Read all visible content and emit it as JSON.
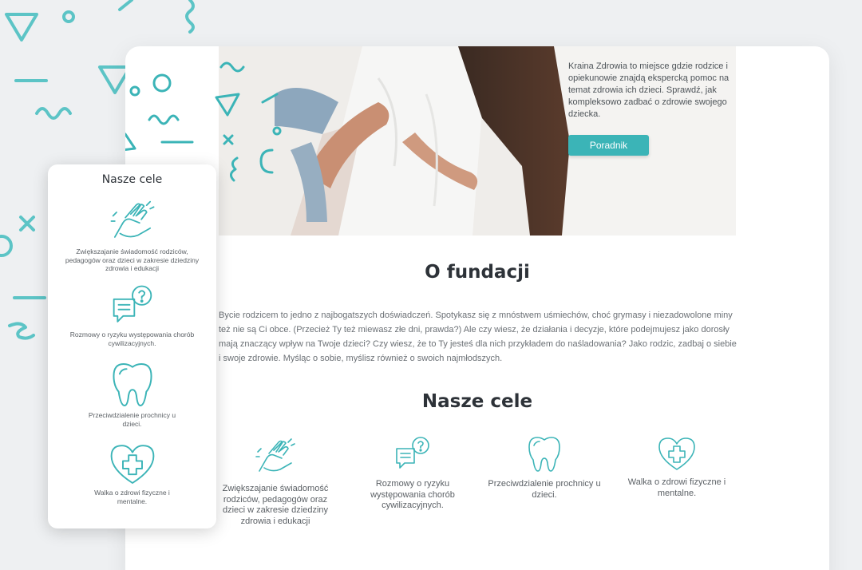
{
  "hero": {
    "description": "Kraina Zdrowia to miejsce gdzie rodzice i opiekunowie znajdą ekspercką pomoc na temat zdrowia ich dzieci. Sprawdź, jak kompleksowo zadbać o zdrowie swojego dziecka.",
    "button_label": "Poradnik"
  },
  "about": {
    "title": "O fundacji",
    "text": "Bycie rodzicem to jedno z najbogatszych doświadczeń. Spotykasz się z mnóstwem uśmiechów, choć grymasy i niezadowolone miny też nie są Ci obce. (Przecież Ty też miewasz złe dni, prawda?) Ale czy wiesz, że działania i decyzje, które podejmujesz jako dorosły mają znaczący wpływ na Twoje dzieci? Czy wiesz, że to Ty jesteś dla nich przykładem do naśladowania? Jako rodzic, zadbaj o siebie i swoje zdrowie. Myśląc o sobie, myślisz również o swoich najmłodszych."
  },
  "goals": {
    "title": "Nasze cele",
    "items": [
      {
        "icon": "hands-icon",
        "label": "Zwiększajanie świadomość rodziców, pedagogów oraz dzieci w zakresie dziedziny zdrowia i edukacji"
      },
      {
        "icon": "chat-question-icon",
        "label": "Rozmowy o ryzyku występowania chorób cywilizacyjnych."
      },
      {
        "icon": "tooth-icon",
        "label": "Przeciwdzialenie prochnicy u dzieci."
      },
      {
        "icon": "heart-cross-icon",
        "label": "Walka o zdrowi fizyczne i mentalne."
      }
    ]
  },
  "mobile": {
    "title": "Nasze cele",
    "items": [
      {
        "icon": "hands-icon",
        "label": "Zwiększajanie świadomość rodziców, pedagogów oraz dzieci w zakresie dziedziny zdrowia i edukacji"
      },
      {
        "icon": "chat-question-icon",
        "label": "Rozmowy o ryzyku występowania chorób cywilizacyjnych."
      },
      {
        "icon": "tooth-icon",
        "label": "Przeciwdzialenie prochnicy u dzieci."
      },
      {
        "icon": "heart-cross-icon",
        "label": "Walka o zdrowi fizyczne i mentalne."
      }
    ]
  },
  "colors": {
    "accent": "#3bb4b7",
    "background": "#eef0f2"
  }
}
